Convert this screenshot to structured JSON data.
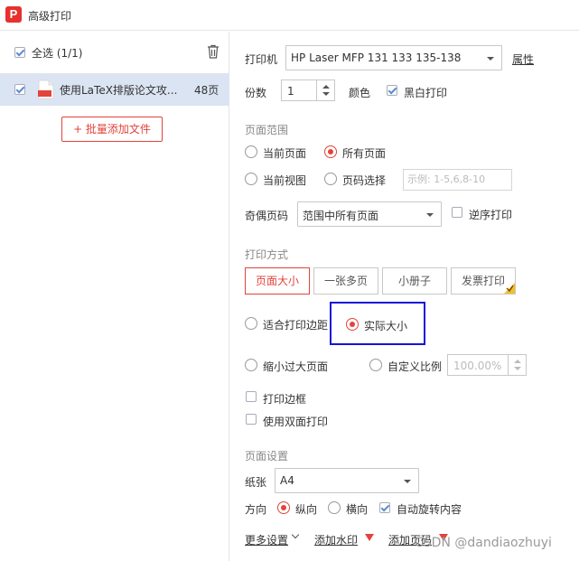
{
  "window": {
    "title": "高级打印",
    "logo_letter": "P"
  },
  "sidebar": {
    "select_all_label": "全选 (1/1)",
    "add_files_label": "+ 批量添加文件",
    "files": [
      {
        "name": "使用LaTeX排版论文攻...",
        "pages": "48页",
        "checked": true
      }
    ]
  },
  "printer": {
    "label": "打印机",
    "selected": "HP Laser MFP 131 133 135-138",
    "properties_link": "属性"
  },
  "copies": {
    "label": "份数",
    "value": "1"
  },
  "color": {
    "label": "颜色",
    "bw_label": "黑白打印",
    "bw_checked": true
  },
  "page_range": {
    "section_title": "页面范围",
    "current_page": "当前页面",
    "all_pages": "所有页面",
    "current_view": "当前视图",
    "page_select": "页码选择",
    "page_input_placeholder": "示例: 1-5,6,8-10",
    "odd_even_label": "奇偶页码",
    "odd_even_selected": "范围中所有页面",
    "reverse_label": "逆序打印"
  },
  "print_mode": {
    "section_title": "打印方式",
    "buttons": [
      "页面大小",
      "一张多页",
      "小册子",
      "发票打印"
    ],
    "fit_margin": "适合打印边距",
    "actual_size": "实际大小",
    "shrink_large": "缩小过大页面",
    "custom_scale": "自定义比例",
    "custom_scale_value": "100.00%",
    "print_border": "打印边框",
    "duplex": "使用双面打印"
  },
  "page_setup": {
    "section_title": "页面设置",
    "paper_label": "纸张",
    "paper_selected": "A4",
    "orientation_label": "方向",
    "portrait": "纵向",
    "landscape": "横向",
    "auto_rotate": "自动旋转内容"
  },
  "footer": {
    "more_settings": "更多设置",
    "add_watermark": "添加水印",
    "add_page_number": "添加页码"
  },
  "watermark": "CSDN @dandiaozhuyi",
  "colors": {
    "accent_red": "#e2433c",
    "highlight_blue": "#1515d6",
    "selected_row": "#dbe4f3"
  }
}
